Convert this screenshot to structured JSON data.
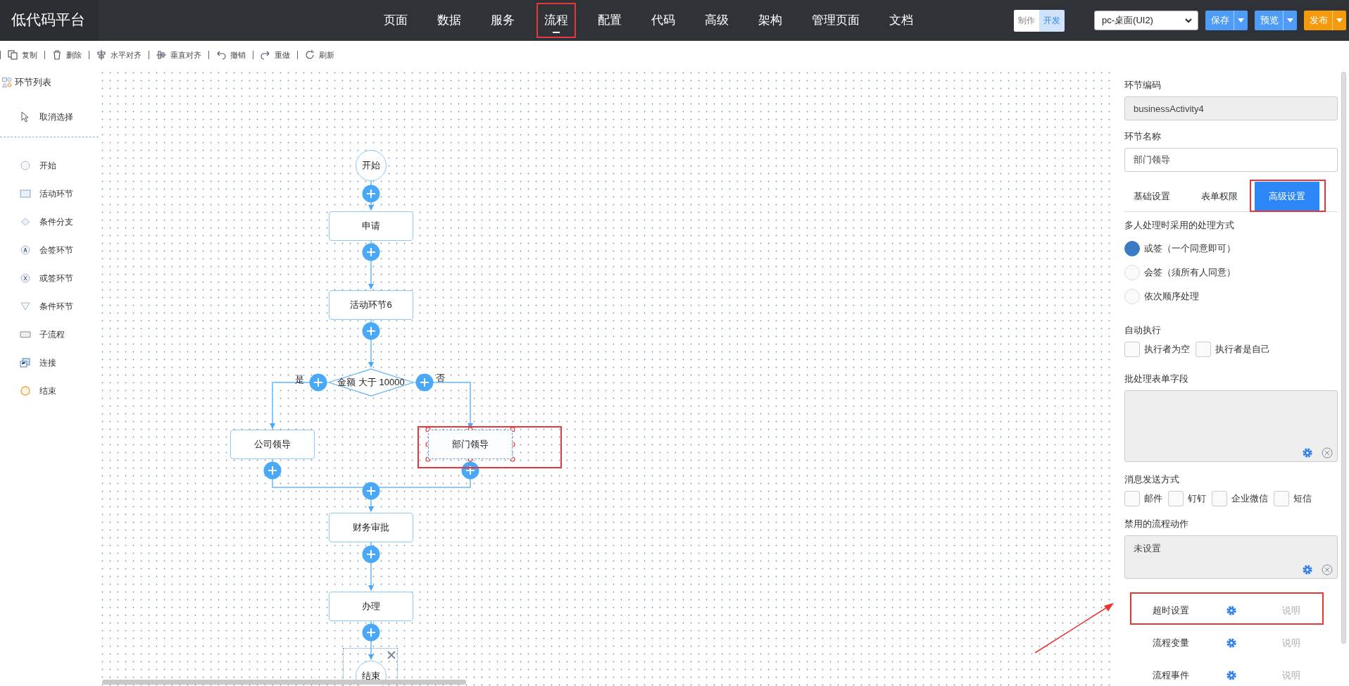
{
  "app": {
    "logo": "低代码平台"
  },
  "nav": [
    {
      "label": "页面",
      "selected": false
    },
    {
      "label": "数据",
      "selected": false
    },
    {
      "label": "服务",
      "selected": false
    },
    {
      "label": "流程",
      "selected": true
    },
    {
      "label": "配置",
      "selected": false
    },
    {
      "label": "代码",
      "selected": false
    },
    {
      "label": "高级",
      "selected": false
    },
    {
      "label": "架构",
      "selected": false
    },
    {
      "label": "管理页面",
      "selected": false
    },
    {
      "label": "文档",
      "selected": false
    }
  ],
  "mode_toggle": [
    {
      "label": "制作",
      "selected": false
    },
    {
      "label": "开发",
      "selected": true
    }
  ],
  "target_select": {
    "value": "pc-桌面(UI2)"
  },
  "actions": [
    {
      "label": "保存",
      "color": "#4e9cf6"
    },
    {
      "label": "预览",
      "color": "#4e9cf6"
    },
    {
      "label": "发布",
      "color": "#f59a0c"
    }
  ],
  "toolbar": [
    {
      "label": "复制"
    },
    {
      "label": "删除"
    },
    {
      "label": "水平对齐"
    },
    {
      "label": "垂直对齐"
    },
    {
      "label": "撤销"
    },
    {
      "label": "重做"
    },
    {
      "label": "刷新"
    }
  ],
  "palette": {
    "title": "环节列表",
    "deselect": "取消选择",
    "items": [
      {
        "label": "开始"
      },
      {
        "label": "活动环节"
      },
      {
        "label": "条件分支"
      },
      {
        "label": "会签环节"
      },
      {
        "label": "或签环节"
      },
      {
        "label": "条件环节"
      },
      {
        "label": "子流程"
      },
      {
        "label": "连接"
      },
      {
        "label": "结束"
      }
    ]
  },
  "diagram": {
    "nodes": [
      {
        "kind": "start",
        "label": "开始",
        "selected": false,
        "hovered": false
      },
      {
        "kind": "activity",
        "label": "申请",
        "selected": false,
        "hovered": false
      },
      {
        "kind": "activity",
        "label": "活动环节6",
        "selected": false,
        "hovered": false
      },
      {
        "kind": "condition",
        "label": "金额 大于 10000",
        "selected": false,
        "hovered": false
      },
      {
        "kind": "activity",
        "label": "公司领导",
        "selected": false,
        "hovered": false
      },
      {
        "kind": "activity",
        "label": "部门领导",
        "selected": true,
        "hovered": false
      },
      {
        "kind": "activity",
        "label": "财务审批",
        "selected": false,
        "hovered": false
      },
      {
        "kind": "activity",
        "label": "办理",
        "selected": false,
        "hovered": false
      },
      {
        "kind": "end",
        "label": "结束",
        "selected": false,
        "hovered": true
      }
    ],
    "branch_labels": [
      "是",
      "否"
    ]
  },
  "properties": {
    "code": {
      "label": "环节编码",
      "value": "businessActivity4",
      "disabled": true
    },
    "name": {
      "label": "环节名称",
      "value": "部门领导",
      "disabled": false
    },
    "tabs": [
      {
        "label": "基础设置",
        "selected": false
      },
      {
        "label": "表单权限",
        "selected": false
      },
      {
        "label": "高级设置",
        "selected": true
      }
    ],
    "multi_mode": {
      "label": "多人处理时采用的处理方式",
      "options": [
        {
          "label": "或签（一个同意即可）",
          "selected": true
        },
        {
          "label": "会签（须所有人同意）",
          "selected": false
        },
        {
          "label": "依次顺序处理",
          "selected": false
        }
      ]
    },
    "auto_exec": {
      "label": "自动执行",
      "options": [
        {
          "label": "执行者为空",
          "checked": false
        },
        {
          "label": "执行者是自己",
          "checked": false
        }
      ]
    },
    "batch_fields": {
      "label": "批处理表单字段"
    },
    "notify": {
      "label": "消息发送方式",
      "options": [
        {
          "label": "邮件",
          "checked": false
        },
        {
          "label": "钉钉",
          "checked": false
        },
        {
          "label": "企业微信",
          "checked": false
        },
        {
          "label": "短信",
          "checked": false
        }
      ]
    },
    "disabled_actions": {
      "label": "禁用的流程动作",
      "value": "未设置"
    },
    "settings_rows": [
      {
        "label": "超时设置",
        "link": "说明"
      },
      {
        "label": "流程变量",
        "link": "说明"
      },
      {
        "label": "流程事件",
        "link": "说明"
      }
    ]
  }
}
